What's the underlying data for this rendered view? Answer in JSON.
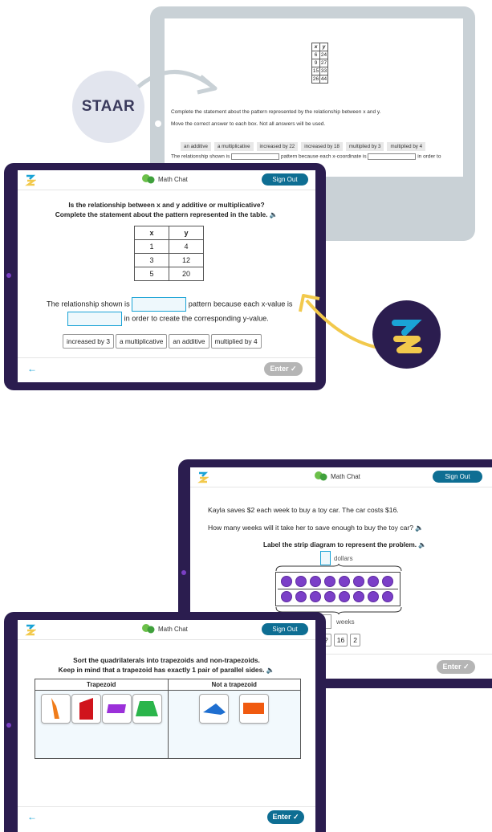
{
  "staar": {
    "badge": "STAAR",
    "table": {
      "headers": [
        "x",
        "y"
      ],
      "rows": [
        [
          "6",
          "24"
        ],
        [
          "9",
          "27"
        ],
        [
          "15",
          "33"
        ],
        [
          "26",
          "44"
        ]
      ]
    },
    "instruction1": "Complete the statement about the pattern represented by the relationship between x and y.",
    "instruction2": "Move the correct answer to each box. Not all answers will be used.",
    "options": [
      "an additive",
      "a multiplicative",
      "increased by 22",
      "increased by 18",
      "multiplied by 3",
      "multiplied by 4"
    ],
    "statement_a": "The relationship shown is",
    "statement_b": "pattern because each x-coordinate is",
    "statement_c": "in order to"
  },
  "app": {
    "chat_title": "Math Chat",
    "sign_out": "Sign Out",
    "enter": "Enter ✓",
    "back": "←"
  },
  "tablet1": {
    "question_line1": "Is the relationship between x and y additive or multiplicative?",
    "question_line2": "Complete the statement about the pattern represented in the table. 🔈",
    "table": {
      "headers": [
        "x",
        "y"
      ],
      "rows": [
        [
          "1",
          "4"
        ],
        [
          "3",
          "12"
        ],
        [
          "5",
          "20"
        ]
      ]
    },
    "statement_a": "The relationship shown is",
    "statement_b": "pattern because each x-value is",
    "statement_c": "in order to create the corresponding y-value.",
    "options": [
      "increased by 3",
      "a multiplicative",
      "an additive",
      "multiplied by 4"
    ]
  },
  "tablet2": {
    "problem": "Kayla saves $2 each week to buy a toy car. The car costs $16.",
    "question": "How many weeks will it take her to save enough to buy the toy car? 🔈",
    "instruction": "Label the strip diagram to represent the problem. 🔈",
    "top_label": "dollars",
    "bottom_label": "weeks",
    "chips": [
      "?",
      "16",
      "2"
    ]
  },
  "tablet3": {
    "question_line1": "Sort the quadrilaterals into trapezoids and non-trapezoids.",
    "question_line2": "Keep in mind that a trapezoid has exactly 1 pair of parallel sides. 🔈",
    "col_left": "Trapezoid",
    "col_right": "Not a trapezoid"
  },
  "colors": {
    "tablet_frame": "#2b1d4f",
    "accent_blue": "#0e6e93",
    "enter_active": "#0e6e93",
    "enter_disabled": "#b5b5b5",
    "circle_purple": "#7b3fc8",
    "arrow_yellow": "#f2c94c"
  }
}
